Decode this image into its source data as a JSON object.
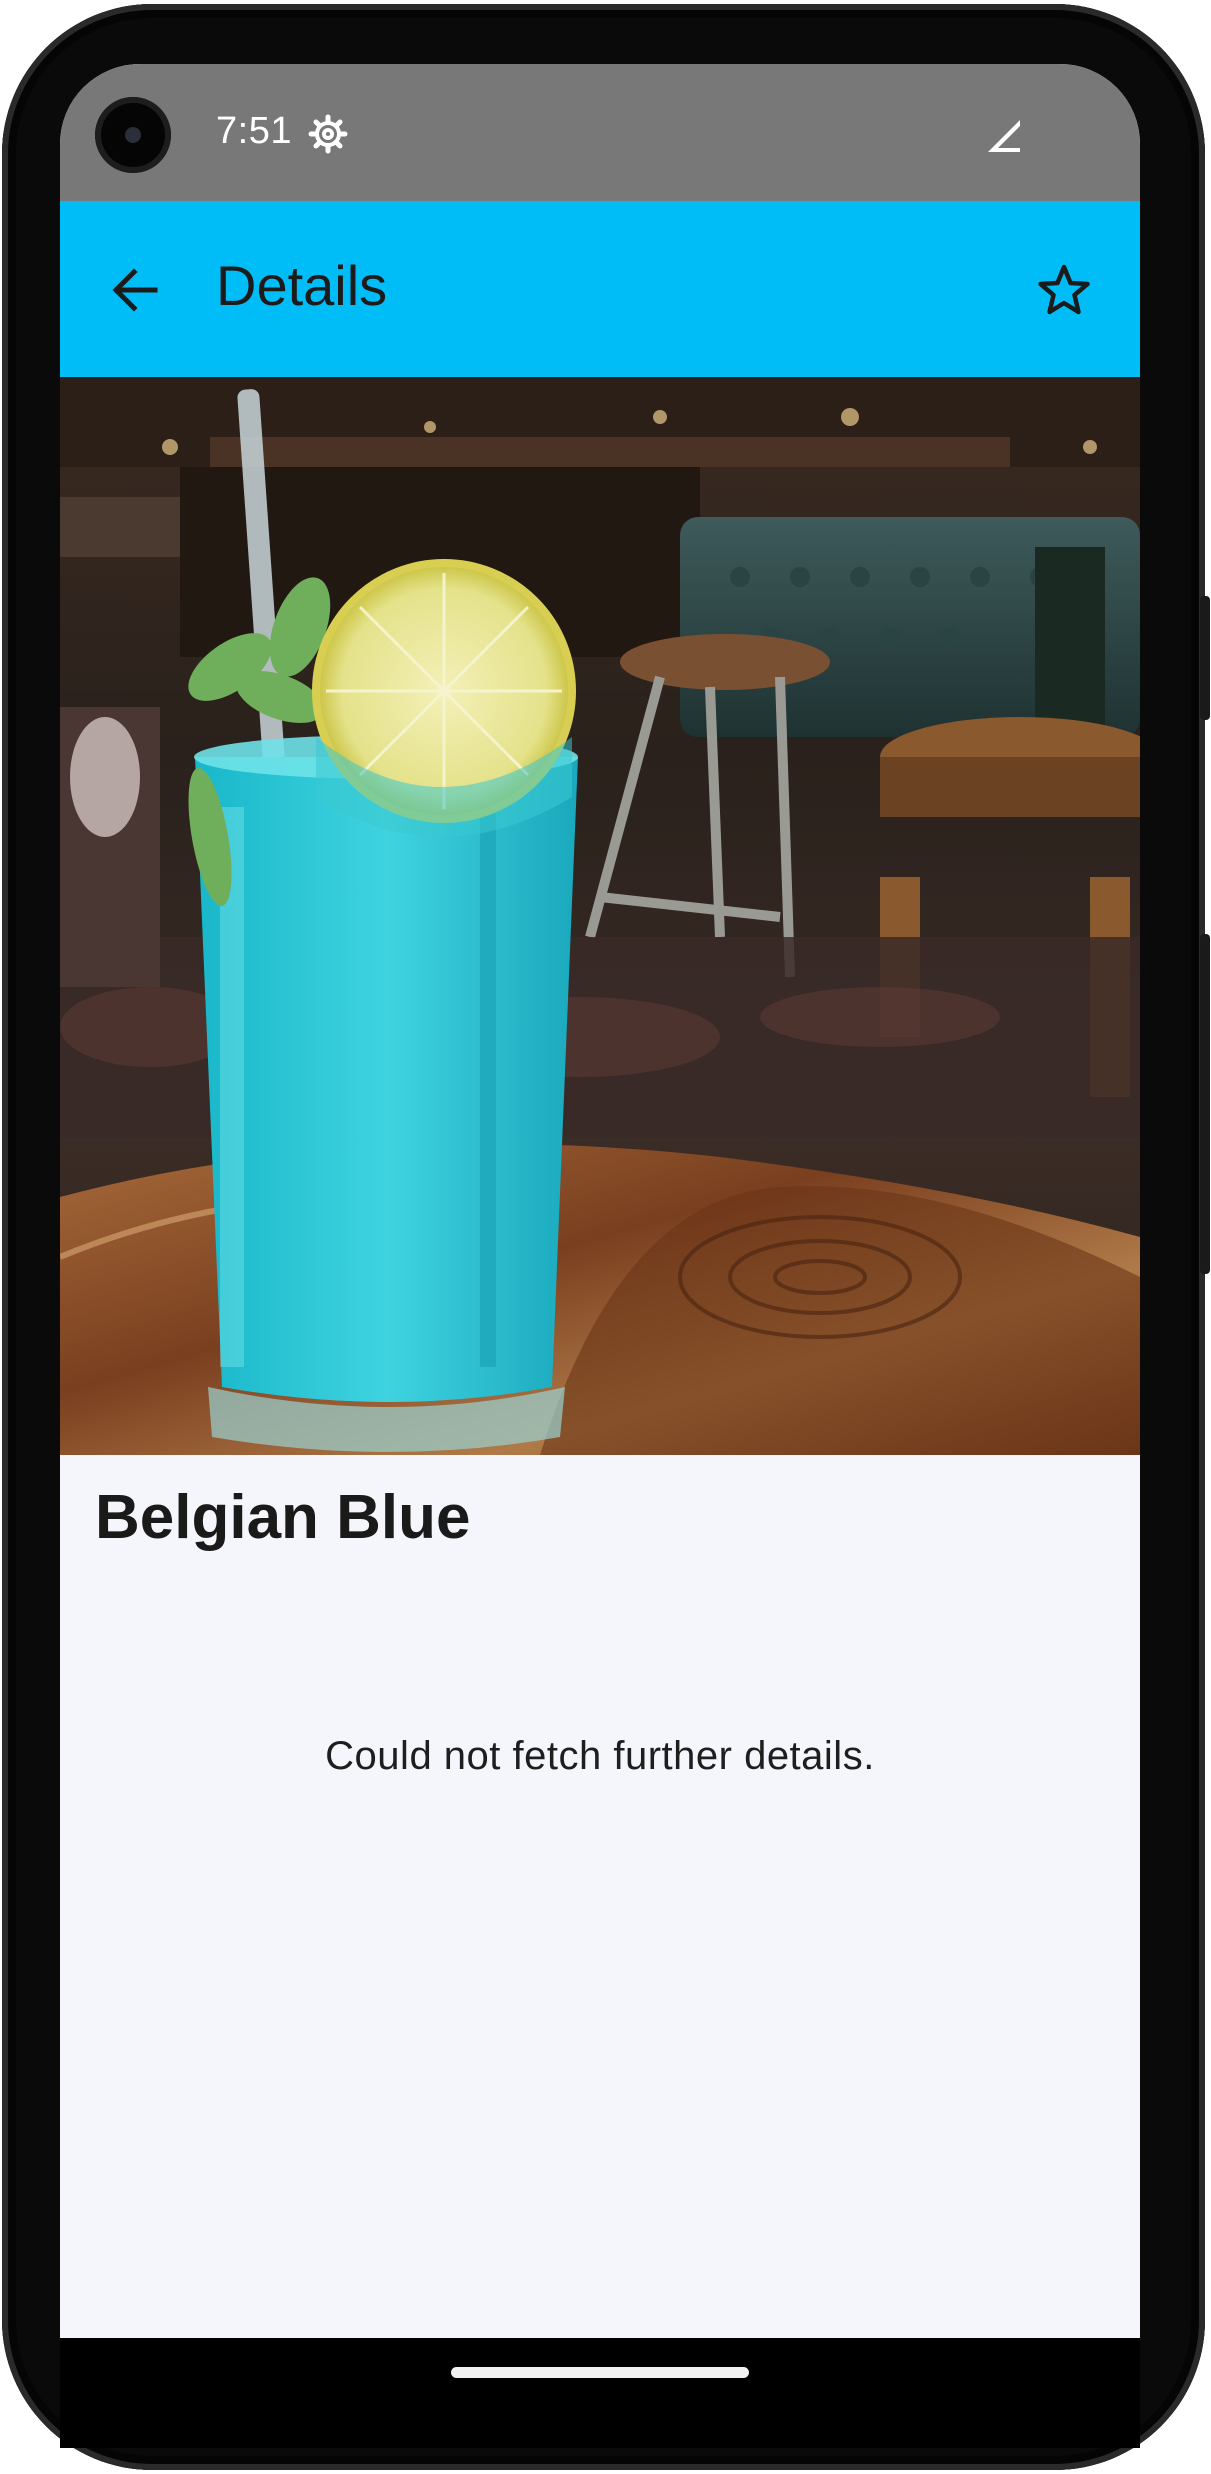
{
  "status_bar": {
    "time": "7:51",
    "settings_icon": "gear-icon",
    "signal_icon": "cell-signal-icon"
  },
  "app_bar": {
    "title": "Details",
    "back_icon": "arrow-back-icon",
    "favorite_icon": "star-outline-icon",
    "background_color": "#00bdf7"
  },
  "detail": {
    "drink_name": "Belgian Blue",
    "image_description_icon": "cocktail-photo",
    "error_message": "Could not fetch further details."
  },
  "nav_bar": {
    "home_indicator": "home-pill"
  }
}
